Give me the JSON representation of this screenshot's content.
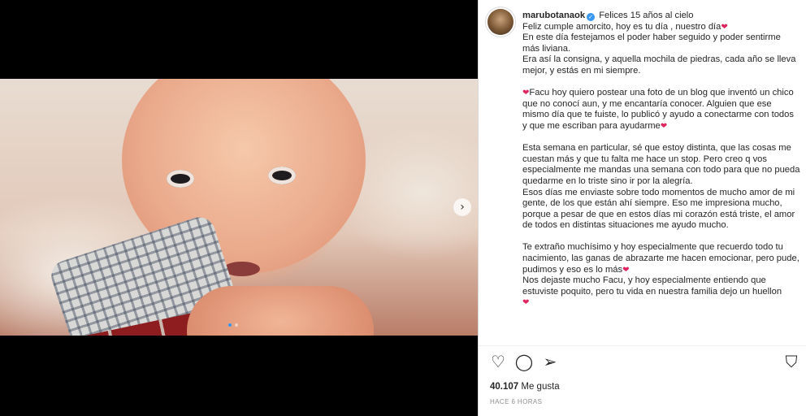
{
  "post": {
    "username": "marubotanaok",
    "caption_lines": [
      "Felices 15 años al cielo",
      "Feliz cumple amorcito, hoy es tu día , nuestro día",
      "En este día festejamos el poder haber seguido y poder sentirme más liviana.",
      "Era así la consigna, y aquella mochila de piedras, cada año se lleva mejor, y estás en mi siempre.",
      "Facu hoy quiero postear una foto de un blog que inventó un chico que no conocí aun, y me encantaría conocer. Alguien que ese mismo día que te fuiste, lo publicó y ayudo a conectarme con todos y que me escriban para ayudarme",
      "Esta semana en particular, sé que estoy distinta, que las cosas me cuestan más y que tu falta me hace un stop. Pero creo q vos especialmente me mandas una semana con todo para que no pueda quedarme en lo triste sino ir por la alegría.",
      "Esos días me enviaste sobre todo momentos de mucho amor de mi gente, de los que están ahí siempre. Eso me impresiona mucho, porque a pesar de que en estos días mi corazón está triste, el amor de todos en distintas situaciones me ayudo mucho.",
      "Te extraño muchísimo y hoy especialmente que recuerdo todo tu nacimiento, las ganas de abrazarte me hacen emocionar, pero pude, pudimos y eso es lo más",
      "Nos dejaste mucho Facu, y hoy especialmente entiendo que estuviste poquito, pero tu vida en nuestra familia dejo un huellon"
    ],
    "heart_glyph": "❤",
    "verified_glyph": "✓",
    "likes_count": "40.107",
    "likes_label": "Me gusta",
    "timestamp": "HACE 6 HORAS"
  },
  "media": {
    "next_glyph": "›",
    "slide_count": 2,
    "current_slide": 1
  },
  "actions": {
    "like_glyph": "♡",
    "comment_glyph": "◯",
    "share_glyph": "➢",
    "save_glyph": "⛉"
  },
  "colors": {
    "heart": "#e0245e",
    "verified": "#3897f0",
    "active_dot": "#3797f0"
  }
}
